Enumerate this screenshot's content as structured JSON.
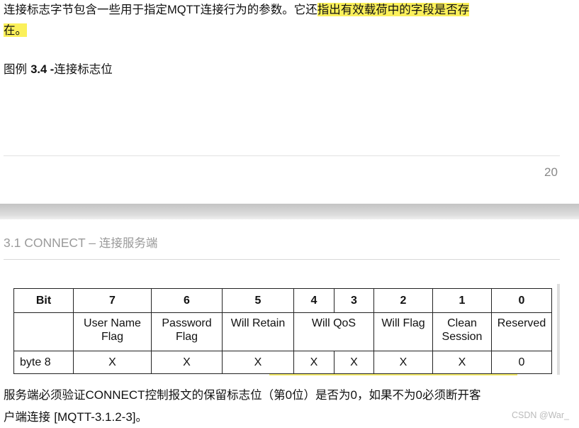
{
  "page1": {
    "paragraph": {
      "line1_pre": "连接标志字节包含一些用于指定",
      "line1_latin": "MQTT",
      "line1_mid": "连接行为的参数。它还",
      "line1_highlight": "指出有效载荷中的字段是否存",
      "line2_highlight": "在。"
    },
    "caption": {
      "prefix": "图例 ",
      "number": "3.4 -",
      "title": "连接标志位"
    },
    "page_number": "20"
  },
  "page2": {
    "header": {
      "section": "3.1 CONNECT – ",
      "title": "连接服务端"
    },
    "table": {
      "header": [
        "Bit",
        "7",
        "6",
        "5",
        "4",
        "3",
        "2",
        "1",
        "0"
      ],
      "names": {
        "user_name": [
          "User Name",
          "Flag"
        ],
        "password": [
          "Password",
          "Flag"
        ],
        "will_retain": "Will Retain",
        "will_qos": "Will QoS",
        "will_flag": "Will Flag",
        "clean_session": [
          "Clean",
          "Session"
        ],
        "reserved": "Reserved"
      },
      "row_label": "byte 8",
      "values": [
        "X",
        "X",
        "X",
        "X",
        "X",
        "X",
        "X",
        "0"
      ]
    },
    "paragraph": {
      "line1_a": "服务端必须验证",
      "line1_b": "CONNECT",
      "line1_c": "控制报文的保留标志位（第",
      "line1_d": "0",
      "line1_e": "位）是否为",
      "line1_f": "0",
      "line1_g": "，如果不为",
      "line1_h": "0",
      "line1_i": "必须断开客",
      "line2_a": "户端连接 ",
      "line2_b": "[MQTT-3.1.2-3]",
      "line2_c": "。"
    }
  },
  "watermark": "CSDN @War_"
}
